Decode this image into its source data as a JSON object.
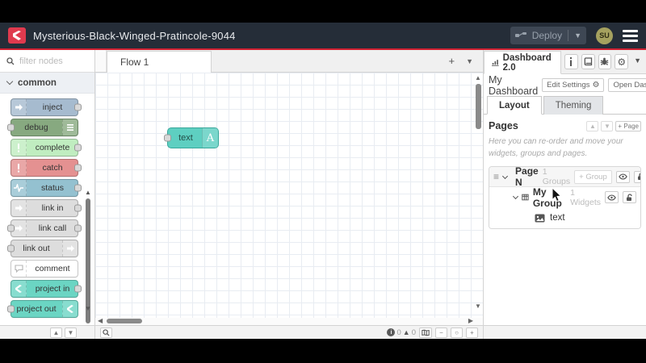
{
  "header": {
    "title": "Mysterious-Black-Winged-Pratincole-9044",
    "deploy_label": "Deploy",
    "avatar_text": "SU"
  },
  "palette": {
    "search_placeholder": "filter nodes",
    "category": "common",
    "nodes": [
      {
        "label": "inject",
        "color": "#a6bbcf"
      },
      {
        "label": "debug",
        "color": "#87a980"
      },
      {
        "label": "complete",
        "color": "#c0edc0"
      },
      {
        "label": "catch",
        "color": "#e49191"
      },
      {
        "label": "status",
        "color": "#94c1d0"
      },
      {
        "label": "link in",
        "color": "#dddddd"
      },
      {
        "label": "link call",
        "color": "#dddddd"
      },
      {
        "label": "link out",
        "color": "#dddddd"
      },
      {
        "label": "comment",
        "color": "#ffffff"
      },
      {
        "label": "project in",
        "color": "#6bd5c3"
      },
      {
        "label": "project out",
        "color": "#6bd5c3"
      }
    ]
  },
  "canvas": {
    "tab_label": "Flow 1",
    "node": {
      "label": "text",
      "icon_letter": "A"
    },
    "footer": {
      "info_count": "0",
      "warning_count": "0"
    }
  },
  "sidebar": {
    "tab_label": "Dashboard 2.0",
    "title": "My Dashboard",
    "edit_settings_label": "Edit Settings",
    "open_dashboard_label": "Open Dashboard",
    "layout_tab": "Layout",
    "theming_tab": "Theming",
    "pages_heading": "Pages",
    "add_page_label": "+ Page",
    "help_text": "Here you can re-order and move your widgets, groups and pages.",
    "tree": {
      "page_name": "Page N",
      "page_count": "1 Groups",
      "add_group_label": "+ Group",
      "group_name": "My Group",
      "group_count": "1 Widgets",
      "widget_name": "text"
    }
  }
}
